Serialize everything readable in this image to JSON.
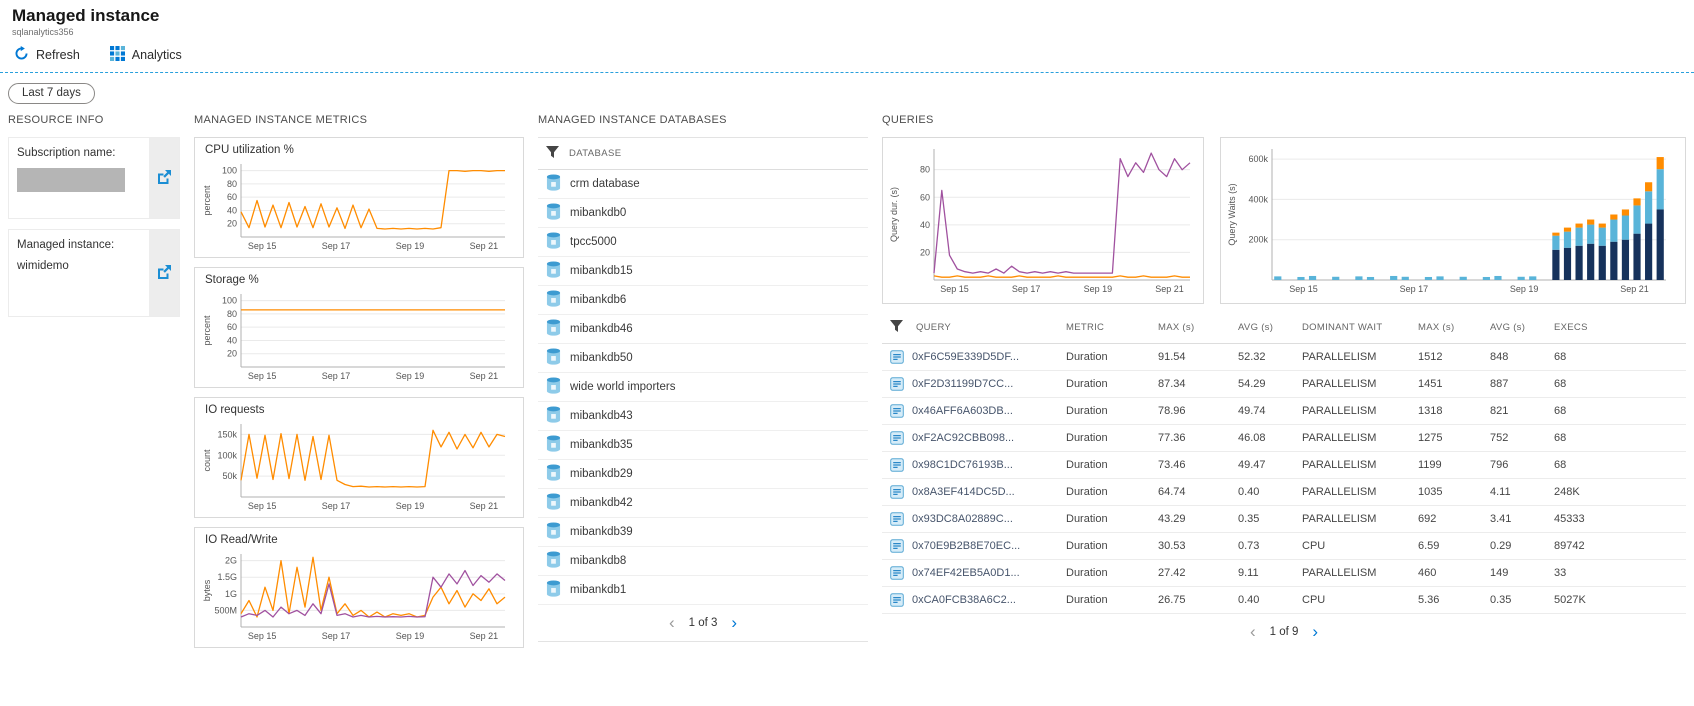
{
  "header": {
    "title": "Managed instance",
    "subtitle": "sqlanalytics356"
  },
  "toolbar": {
    "refresh_label": "Refresh",
    "analytics_label": "Analytics"
  },
  "time_range_label": "Last 7 days",
  "icons": {
    "chevron_left": "‹",
    "chevron_right": "›"
  },
  "colors": {
    "accent": "#0078d4",
    "orange": "#ff8c00",
    "purple": "#a0519f",
    "navy": "#16325c",
    "lightblue": "#59b4d9"
  },
  "resource_info": {
    "section_title": "RESOURCE INFO",
    "subscription_label": "Subscription name:",
    "instance_label": "Managed instance:",
    "instance_value": "wimidemo"
  },
  "metrics": {
    "section_title": "MANAGED INSTANCE METRICS"
  },
  "databases": {
    "section_title": "MANAGED INSTANCE DATABASES",
    "column_header": "DATABASE",
    "items": [
      "crm database",
      "mibankdb0",
      "tpcc5000",
      "mibankdb15",
      "mibankdb6",
      "mibankdb46",
      "mibankdb50",
      "wide world importers",
      "mibankdb43",
      "mibankdb35",
      "mibankdb29",
      "mibankdb42",
      "mibankdb39",
      "mibankdb8",
      "mibankdb1"
    ],
    "pagination": {
      "label": "1 of 3"
    }
  },
  "queries": {
    "section_title": "QUERIES",
    "table": {
      "columns": [
        "QUERY",
        "METRIC",
        "MAX (s)",
        "AVG (s)",
        "DOMINANT WAIT",
        "MAX (s)",
        "AVG (s)",
        "EXECS"
      ],
      "rows": [
        [
          "0xF6C59E339D5DF...",
          "Duration",
          "91.54",
          "52.32",
          "PARALLELISM",
          "1512",
          "848",
          "68"
        ],
        [
          "0xF2D31199D7CC...",
          "Duration",
          "87.34",
          "54.29",
          "PARALLELISM",
          "1451",
          "887",
          "68"
        ],
        [
          "0x46AFF6A603DB...",
          "Duration",
          "78.96",
          "49.74",
          "PARALLELISM",
          "1318",
          "821",
          "68"
        ],
        [
          "0xF2AC92CBB098...",
          "Duration",
          "77.36",
          "46.08",
          "PARALLELISM",
          "1275",
          "752",
          "68"
        ],
        [
          "0x98C1DC76193B...",
          "Duration",
          "73.46",
          "49.47",
          "PARALLELISM",
          "1199",
          "796",
          "68"
        ],
        [
          "0x8A3EF414DC5D...",
          "Duration",
          "64.74",
          "0.40",
          "PARALLELISM",
          "1035",
          "4.11",
          "248K"
        ],
        [
          "0x93DC8A02889C...",
          "Duration",
          "43.29",
          "0.35",
          "PARALLELISM",
          "692",
          "3.41",
          "45333"
        ],
        [
          "0x70E9B2B8E70EC...",
          "Duration",
          "30.53",
          "0.73",
          "CPU",
          "6.59",
          "0.29",
          "89742"
        ],
        [
          "0x74EF42EB5A0D1...",
          "Duration",
          "27.42",
          "9.11",
          "PARALLELISM",
          "460",
          "149",
          "33"
        ],
        [
          "0xCA0FCB38A6C2...",
          "Duration",
          "26.75",
          "0.40",
          "CPU",
          "5.36",
          "0.35",
          "5027K"
        ]
      ]
    },
    "pagination": {
      "label": "1 of 9"
    }
  },
  "chart_data": [
    {
      "id": "cpu",
      "type": "line",
      "title": "CPU utilization %",
      "ylabel": "percent",
      "ymax": 110,
      "ml": 40,
      "yticks": [
        {
          "v": 20,
          "label": "20"
        },
        {
          "v": 40,
          "label": "40"
        },
        {
          "v": 60,
          "label": "60"
        },
        {
          "v": 80,
          "label": "80"
        },
        {
          "v": 100,
          "label": "100"
        }
      ],
      "xticks": [
        {
          "pos": 0.08,
          "label": "Sep 15"
        },
        {
          "pos": 0.36,
          "label": "Sep 17"
        },
        {
          "pos": 0.64,
          "label": "Sep 19"
        },
        {
          "pos": 0.92,
          "label": "Sep 21"
        }
      ],
      "series": [
        {
          "name": "cpu_percent",
          "color": "#ff8c00",
          "values": [
            38,
            14,
            55,
            15,
            48,
            14,
            52,
            15,
            46,
            14,
            50,
            15,
            44,
            13,
            48,
            14,
            42,
            13,
            12,
            13,
            12,
            13,
            12,
            13,
            12,
            14,
            100,
            100,
            99,
            100,
            100,
            99,
            100,
            100
          ]
        }
      ]
    },
    {
      "id": "storage",
      "type": "line",
      "title": "Storage %",
      "ylabel": "percent",
      "ymax": 110,
      "ml": 40,
      "yticks": [
        {
          "v": 20,
          "label": "20"
        },
        {
          "v": 40,
          "label": "40"
        },
        {
          "v": 60,
          "label": "60"
        },
        {
          "v": 80,
          "label": "80"
        },
        {
          "v": 100,
          "label": "100"
        }
      ],
      "xticks": [
        {
          "pos": 0.08,
          "label": "Sep 15"
        },
        {
          "pos": 0.36,
          "label": "Sep 17"
        },
        {
          "pos": 0.64,
          "label": "Sep 19"
        },
        {
          "pos": 0.92,
          "label": "Sep 21"
        }
      ],
      "series": [
        {
          "name": "storage_percent",
          "color": "#ff8c00",
          "values": [
            86,
            86,
            86,
            86,
            86,
            86,
            86,
            86,
            86,
            86,
            86,
            86
          ]
        }
      ]
    },
    {
      "id": "io_requests",
      "type": "line",
      "title": "IO requests",
      "ylabel": "count",
      "ymax": 175,
      "ml": 40,
      "yticks": [
        {
          "v": 50,
          "label": "50k"
        },
        {
          "v": 100,
          "label": "100k"
        },
        {
          "v": 150,
          "label": "150k"
        }
      ],
      "xticks": [
        {
          "pos": 0.08,
          "label": "Sep 15"
        },
        {
          "pos": 0.36,
          "label": "Sep 17"
        },
        {
          "pos": 0.64,
          "label": "Sep 19"
        },
        {
          "pos": 0.92,
          "label": "Sep 21"
        }
      ],
      "series": [
        {
          "name": "io_count",
          "color": "#ff8c00",
          "values": [
            40,
            150,
            45,
            148,
            42,
            152,
            44,
            150,
            40,
            145,
            42,
            148,
            40,
            30,
            25,
            26,
            24,
            25,
            24,
            25,
            24,
            25,
            24,
            25,
            160,
            120,
            155,
            115,
            150,
            118,
            155,
            120,
            150,
            145
          ]
        }
      ]
    },
    {
      "id": "io_rw",
      "type": "line",
      "title": "IO Read/Write",
      "ylabel": "bytes",
      "ymax": 2200,
      "ml": 40,
      "yticks": [
        {
          "v": 500,
          "label": "500M"
        },
        {
          "v": 1000,
          "label": "1G"
        },
        {
          "v": 1500,
          "label": "1.5G"
        },
        {
          "v": 2000,
          "label": "2G"
        }
      ],
      "xticks": [
        {
          "pos": 0.08,
          "label": "Sep 15"
        },
        {
          "pos": 0.36,
          "label": "Sep 17"
        },
        {
          "pos": 0.64,
          "label": "Sep 19"
        },
        {
          "pos": 0.92,
          "label": "Sep 21"
        }
      ],
      "series": [
        {
          "name": "read",
          "color": "#ff8c00",
          "values": [
            400,
            800,
            300,
            1200,
            500,
            2000,
            400,
            1800,
            600,
            2100,
            500,
            1500,
            400,
            700,
            350,
            500,
            300,
            450,
            300,
            400,
            350,
            400,
            300,
            350,
            900,
            1200,
            700,
            1100,
            600,
            1000,
            800,
            1150,
            700,
            900
          ]
        },
        {
          "name": "write",
          "color": "#a0519f",
          "values": [
            300,
            400,
            350,
            500,
            300,
            600,
            400,
            500,
            350,
            700,
            400,
            1300,
            350,
            400,
            300,
            350,
            300,
            320,
            300,
            310,
            300,
            320,
            300,
            310,
            1500,
            1200,
            1600,
            1300,
            1700,
            1250,
            1550,
            1350,
            1600,
            1400
          ]
        }
      ]
    },
    {
      "id": "query_dur",
      "type": "line",
      "ylabel": "Query dur. (s)",
      "ymax": 95,
      "ml": 46,
      "yticks": [
        {
          "v": 20,
          "label": "20"
        },
        {
          "v": 40,
          "label": "40"
        },
        {
          "v": 60,
          "label": "60"
        },
        {
          "v": 80,
          "label": "80"
        }
      ],
      "xticks": [
        {
          "pos": 0.08,
          "label": "Sep 15"
        },
        {
          "pos": 0.36,
          "label": "Sep 17"
        },
        {
          "pos": 0.64,
          "label": "Sep 19"
        },
        {
          "pos": 0.92,
          "label": "Sep 21"
        }
      ],
      "series": [
        {
          "name": "duration",
          "color": "#a0519f",
          "values": [
            5,
            65,
            18,
            8,
            6,
            5,
            6,
            5,
            8,
            5,
            10,
            6,
            5,
            6,
            5,
            6,
            5,
            6,
            5,
            5,
            5,
            5,
            5,
            5,
            88,
            75,
            85,
            78,
            92,
            80,
            75,
            88,
            80,
            85
          ]
        },
        {
          "name": "baseline",
          "color": "#ff8c00",
          "values": [
            3,
            2,
            2,
            3,
            2,
            2,
            2,
            3,
            2,
            2,
            2,
            3,
            2,
            2,
            2,
            2,
            3,
            2,
            2,
            2,
            2,
            2,
            2,
            2,
            3,
            2,
            2,
            3,
            2,
            2,
            2,
            3,
            2,
            2
          ]
        }
      ]
    },
    {
      "id": "query_waits",
      "type": "stacked-bar",
      "ylabel": "Query Waits (s)",
      "ymax": 650,
      "ml": 46,
      "yticks": [
        {
          "v": 200,
          "label": "200k"
        },
        {
          "v": 400,
          "label": "400k"
        },
        {
          "v": 600,
          "label": "600k"
        }
      ],
      "xticks": [
        {
          "pos": 0.08,
          "label": "Sep 15"
        },
        {
          "pos": 0.36,
          "label": "Sep 17"
        },
        {
          "pos": 0.64,
          "label": "Sep 19"
        },
        {
          "pos": 0.92,
          "label": "Sep 21"
        }
      ],
      "series": [
        {
          "name": "wait_navy",
          "color": "#16325c",
          "values": [
            0,
            0,
            0,
            0,
            0,
            0,
            0,
            0,
            0,
            0,
            0,
            0,
            0,
            0,
            0,
            0,
            0,
            0,
            0,
            0,
            0,
            0,
            0,
            0,
            150,
            160,
            170,
            180,
            170,
            190,
            200,
            230,
            280,
            350
          ]
        },
        {
          "name": "wait_lightblue",
          "color": "#59b4d9",
          "values": [
            18,
            0,
            15,
            20,
            0,
            16,
            0,
            18,
            15,
            0,
            20,
            16,
            0,
            15,
            18,
            0,
            16,
            0,
            15,
            20,
            0,
            16,
            18,
            0,
            70,
            80,
            90,
            95,
            90,
            110,
            120,
            140,
            160,
            200
          ]
        },
        {
          "name": "wait_orange",
          "color": "#ff8c00",
          "values": [
            0,
            0,
            0,
            0,
            0,
            0,
            0,
            0,
            0,
            0,
            0,
            0,
            0,
            0,
            0,
            0,
            0,
            0,
            0,
            0,
            0,
            0,
            0,
            0,
            15,
            20,
            20,
            25,
            20,
            25,
            30,
            35,
            45,
            60
          ]
        }
      ]
    }
  ]
}
